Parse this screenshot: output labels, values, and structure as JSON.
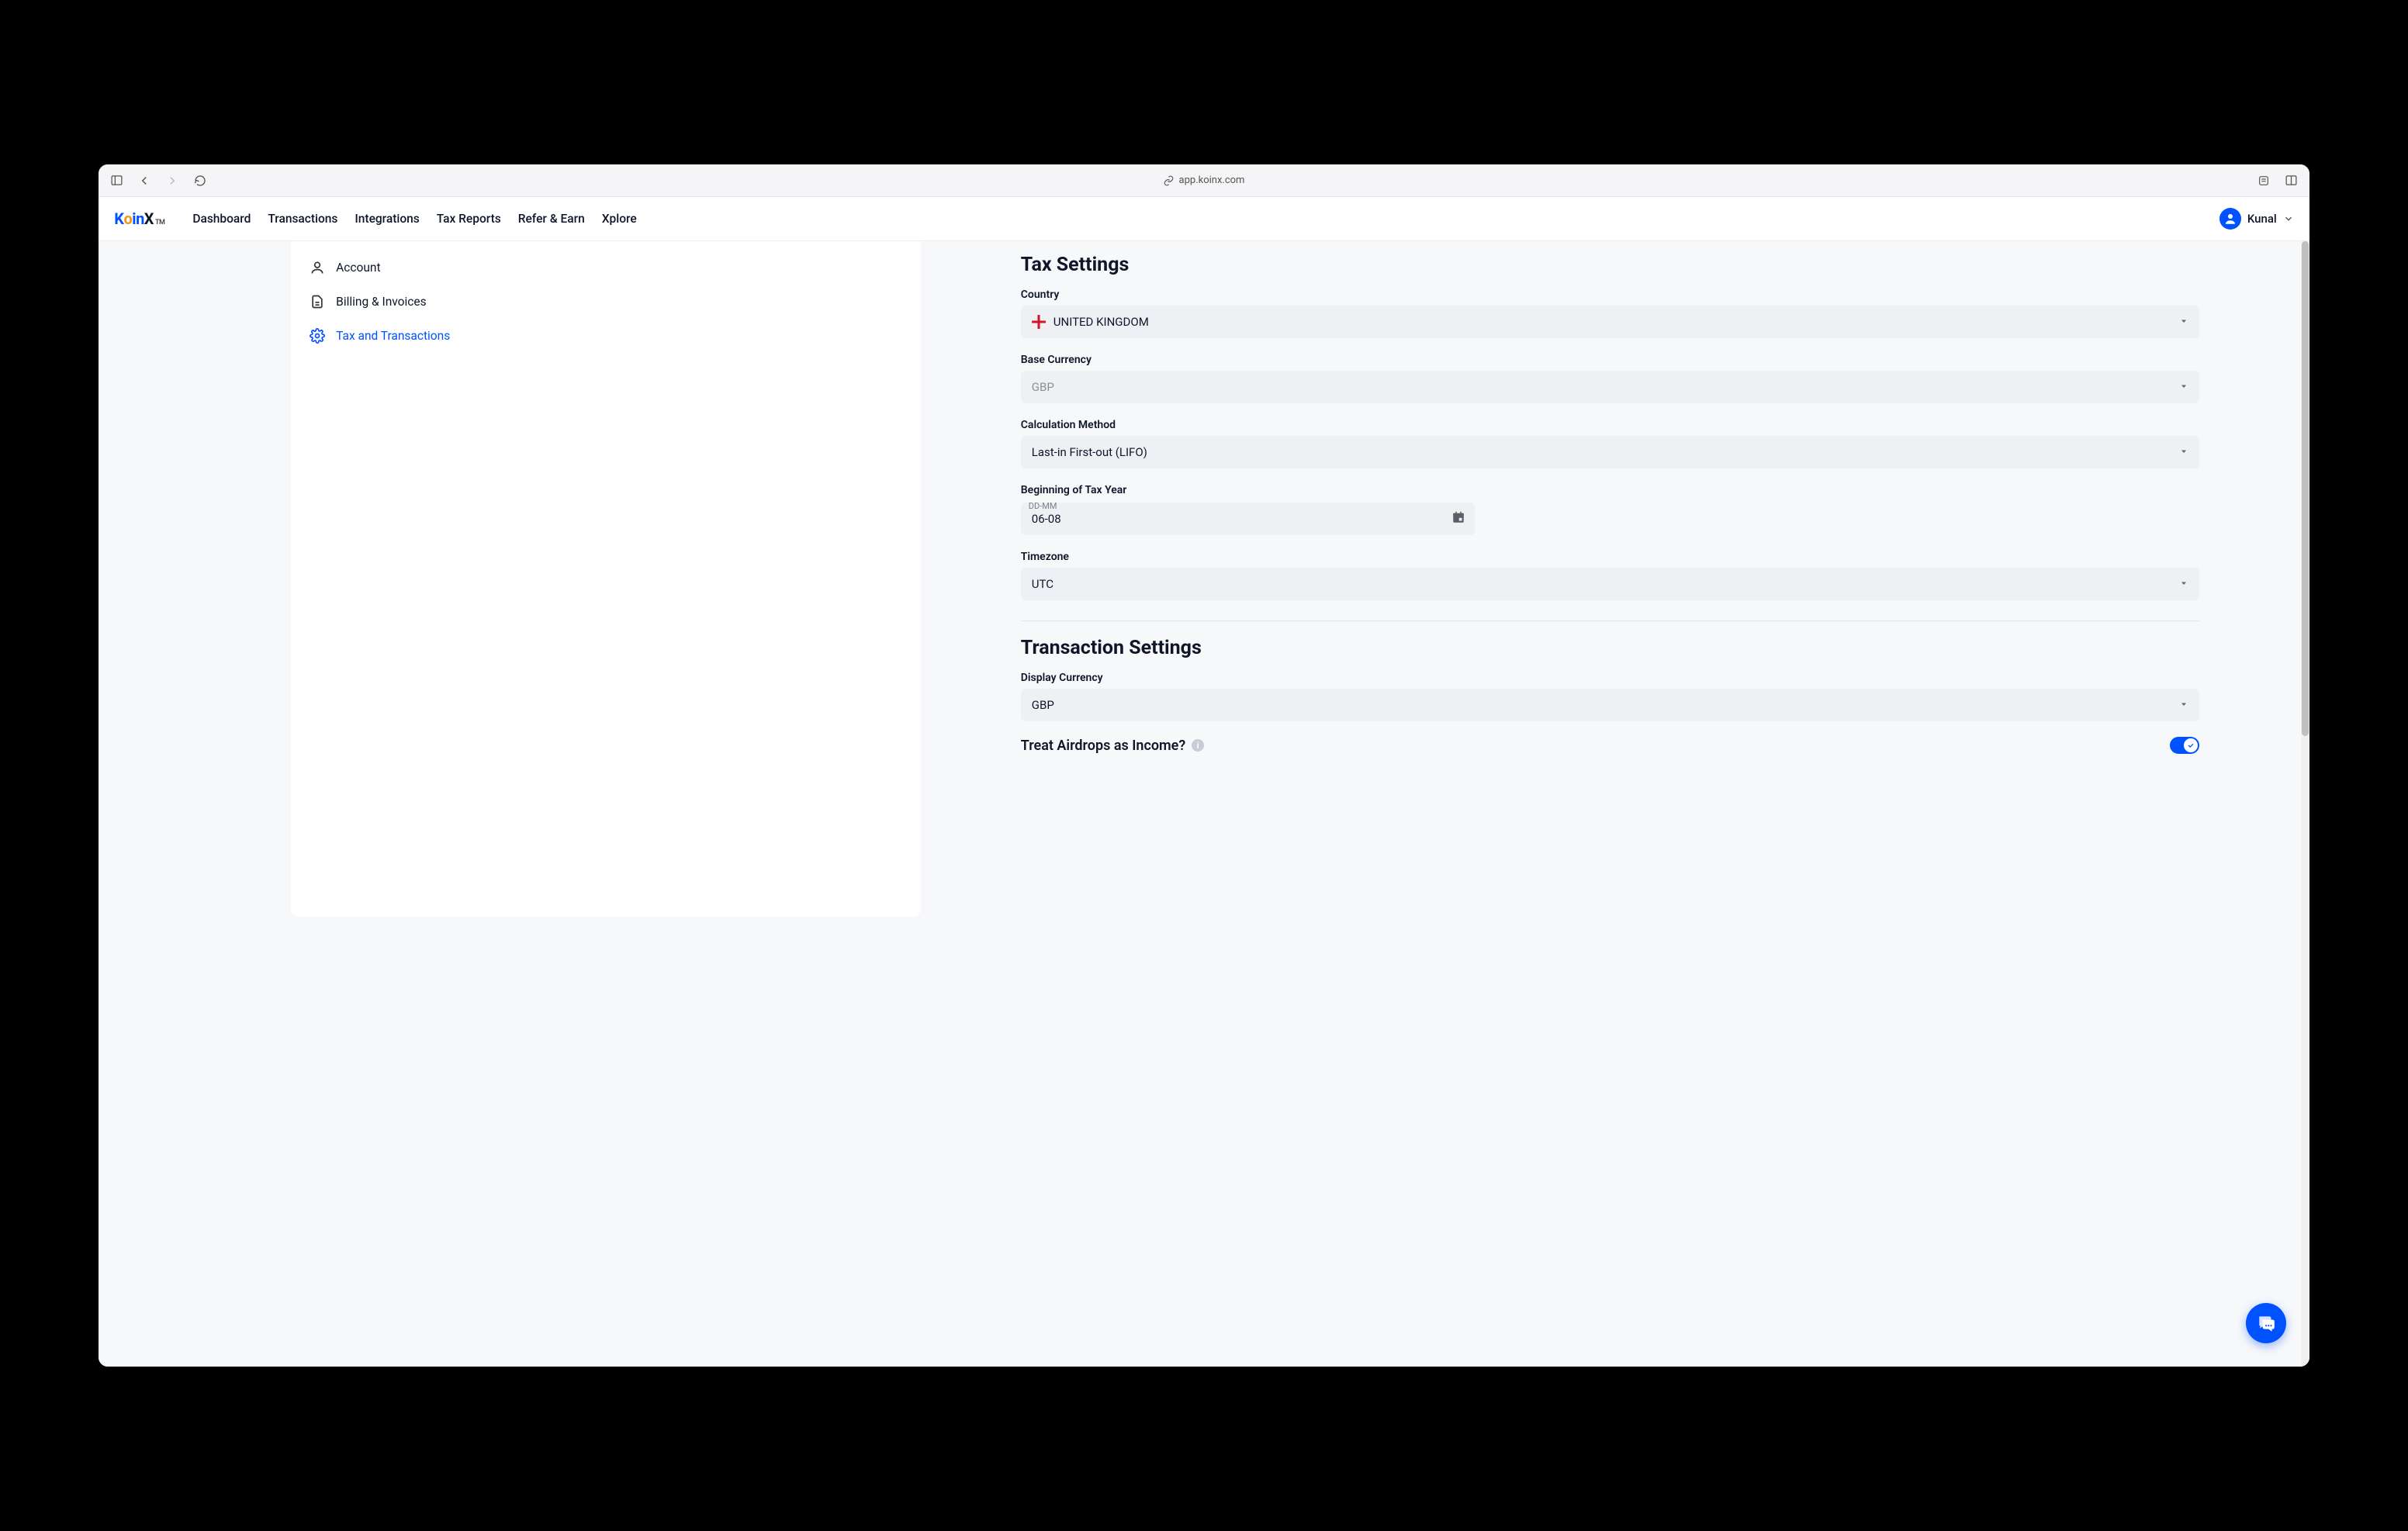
{
  "browser": {
    "url": "app.koinx.com"
  },
  "header": {
    "logo": {
      "part1": "Koin",
      "part2": "X",
      "tm": "TM"
    },
    "nav": [
      "Dashboard",
      "Transactions",
      "Integrations",
      "Tax Reports",
      "Refer & Earn",
      "Xplore"
    ],
    "user": "Kunal"
  },
  "sidebar": {
    "items": [
      {
        "icon": "person",
        "label": "Account"
      },
      {
        "icon": "document",
        "label": "Billing & Invoices"
      },
      {
        "icon": "gear",
        "label": "Tax and Transactions",
        "active": true
      }
    ]
  },
  "tax_settings": {
    "title": "Tax Settings",
    "country": {
      "label": "Country",
      "value": "UNITED KINGDOM"
    },
    "base_currency": {
      "label": "Base Currency",
      "value": "GBP"
    },
    "calc_method": {
      "label": "Calculation Method",
      "value": "Last-in First-out (LIFO)"
    },
    "tax_year": {
      "label": "Beginning of Tax Year",
      "hint": "DD-MM",
      "value": "06-08"
    },
    "timezone": {
      "label": "Timezone",
      "value": "UTC"
    }
  },
  "txn_settings": {
    "title": "Transaction Settings",
    "display_currency": {
      "label": "Display Currency",
      "value": "GBP"
    },
    "airdrops": {
      "label": "Treat Airdrops as Income?",
      "on": true
    }
  }
}
